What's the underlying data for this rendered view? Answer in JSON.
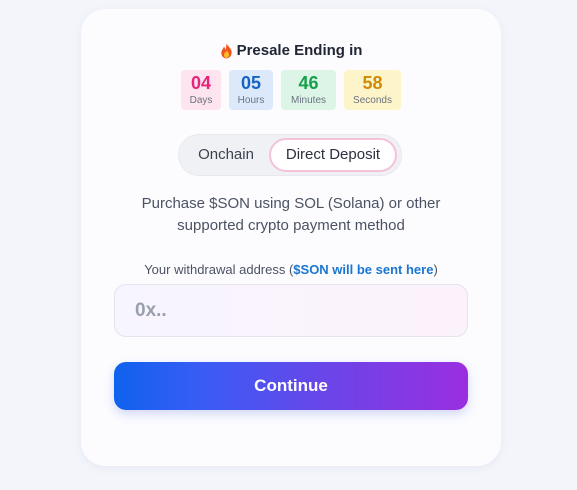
{
  "presale": {
    "title": "Presale Ending in",
    "icon": "fire-icon"
  },
  "countdown": [
    {
      "value": "04",
      "label": "Days",
      "bg": "#fde4ee",
      "color": "#e8247a"
    },
    {
      "value": "05",
      "label": "Hours",
      "bg": "#dce9fb",
      "color": "#1565c0"
    },
    {
      "value": "46",
      "label": "Minutes",
      "bg": "#dcf5e6",
      "color": "#16a04c"
    },
    {
      "value": "58",
      "label": "Seconds",
      "bg": "#fdf5c9",
      "color": "#d08a07"
    }
  ],
  "tabs": {
    "onchain": "Onchain",
    "direct": "Direct Deposit",
    "active": "direct"
  },
  "description": "Purchase $SON using SOL (Solana) or other supported crypto payment method",
  "address": {
    "label_prefix": "Your withdrawal address (",
    "label_highlight": "$SON will be sent here",
    "label_suffix": ")",
    "placeholder": "0x..",
    "value": ""
  },
  "continue_label": "Continue",
  "colors": {
    "accent_start": "#0f62ee",
    "accent_end": "#9a2ee0",
    "link": "#1976d2"
  }
}
